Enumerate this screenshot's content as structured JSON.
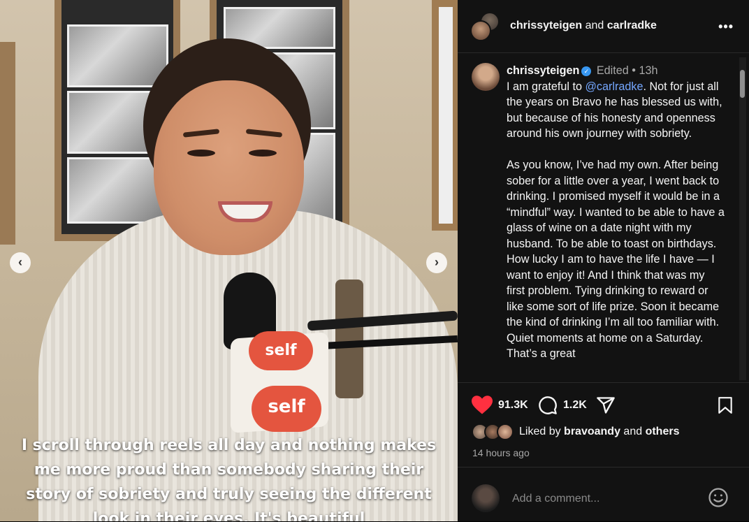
{
  "media": {
    "caption": "I scroll through reels all day and nothing makes me more proud than somebody sharing their story of sobriety and truly seeing the different look in their eyes. It's beautiful",
    "mic_brand_top": "self",
    "mic_brand_bottom": "self",
    "prev_arrow": "‹",
    "next_arrow": "›"
  },
  "header": {
    "user1": "chrissyteigen",
    "conjunction": "and",
    "user2": "carlradke",
    "more_icon": "more-horizontal-icon",
    "more_glyph": "•••"
  },
  "post": {
    "author": "chrissyteigen",
    "edited": "Edited",
    "dot": "•",
    "age": "13h",
    "text_before_mention": "I am grateful to ",
    "mention": "@carlradke",
    "text_after_mention": ". Not for just all the years on Bravo he has blessed us with, but because of his honesty and openness around his own journey with sobriety.\n\nAs you know, I’ve had my own. After being sober for a little over a year, I went back to drinking. I promised myself it would be in a “mindful” way. I wanted to be able to have a glass of wine on a date night with my husband. To be able to toast on birthdays. How lucky I am to have the life I have — I want to enjoy it! And I think that was my first problem. Tying drinking to reward or like some sort of life prize. Soon it became the kind of drinking I’m all too familiar with. Quiet moments at home on a Saturday. That’s a great"
  },
  "actions": {
    "likes": "91.3K",
    "comments": "1.2K",
    "liked_by_prefix": "Liked by",
    "liked_by_user": "bravoandy",
    "liked_by_and": "and",
    "liked_by_others": "others",
    "time_ago": "14 hours ago",
    "colors": {
      "heart": "#ff3040",
      "mention": "#75a7ff",
      "verified": "#3897f0"
    }
  },
  "comment": {
    "placeholder": "Add a comment..."
  }
}
